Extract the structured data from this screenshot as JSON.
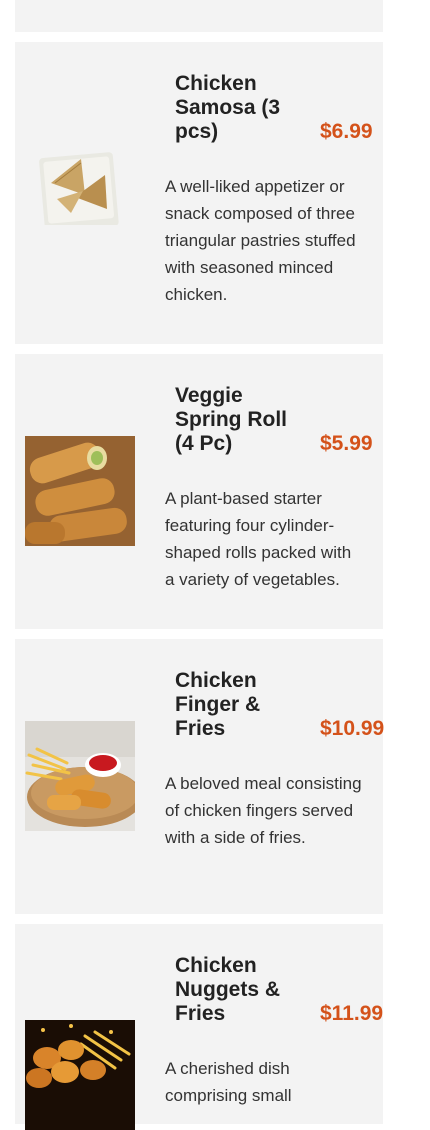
{
  "menu": {
    "items": [
      {
        "name": "Chicken Samosa (3 pcs)",
        "price": "$6.99",
        "description": "A well-liked appetizer or snack composed of three triangular pastries stuffed with seasoned minced chicken.",
        "image_icon": "samosa-plate-image"
      },
      {
        "name": "Veggie Spring Roll (4 Pc)",
        "price": "$5.99",
        "description": "A plant-based starter featuring four cylinder-shaped rolls packed with a variety of vegetables.",
        "image_icon": "spring-roll-image"
      },
      {
        "name": "Chicken Finger & Fries",
        "price": "$10.99",
        "description": "A beloved meal consisting of chicken fingers served with a side of fries.",
        "image_icon": "chicken-finger-image"
      },
      {
        "name": "Chicken Nuggets & Fries",
        "price": "$11.99",
        "description": "A cherished dish comprising small",
        "image_icon": "chicken-nuggets-image"
      }
    ]
  },
  "colors": {
    "card_background": "#f3f3f3",
    "price": "#d4521a",
    "title": "#222222"
  }
}
